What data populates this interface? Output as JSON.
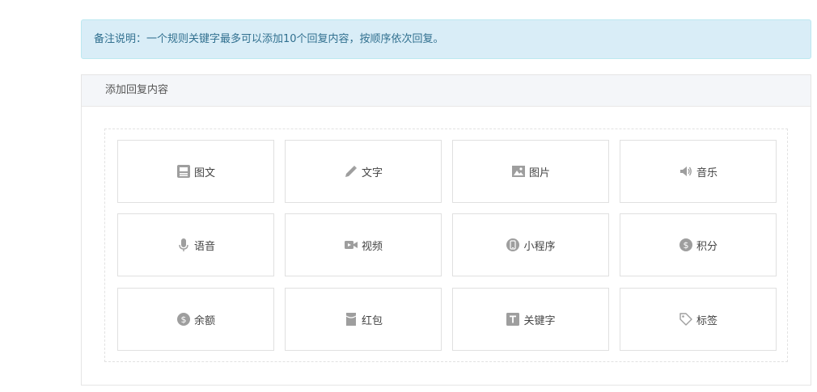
{
  "notice": {
    "text": "备注说明：一个规则关键字最多可以添加10个回复内容，按顺序依次回复。"
  },
  "panel": {
    "title": "添加回复内容"
  },
  "tiles": [
    {
      "label": "图文",
      "icon": "news-icon"
    },
    {
      "label": "文字",
      "icon": "pencil-icon"
    },
    {
      "label": "图片",
      "icon": "image-icon"
    },
    {
      "label": "音乐",
      "icon": "speaker-icon"
    },
    {
      "label": "语音",
      "icon": "microphone-icon"
    },
    {
      "label": "视频",
      "icon": "video-camera-icon"
    },
    {
      "label": "小程序",
      "icon": "mini-program-icon"
    },
    {
      "label": "积分",
      "icon": "dollar-circle-icon"
    },
    {
      "label": "余额",
      "icon": "dollar-circle-icon"
    },
    {
      "label": "红包",
      "icon": "red-packet-icon"
    },
    {
      "label": "关键字",
      "icon": "text-t-icon"
    },
    {
      "label": "标签",
      "icon": "tag-icon"
    }
  ],
  "colors": {
    "icon": "#9e9e9e",
    "notice_bg": "#d9edf7",
    "notice_text": "#31708f"
  }
}
